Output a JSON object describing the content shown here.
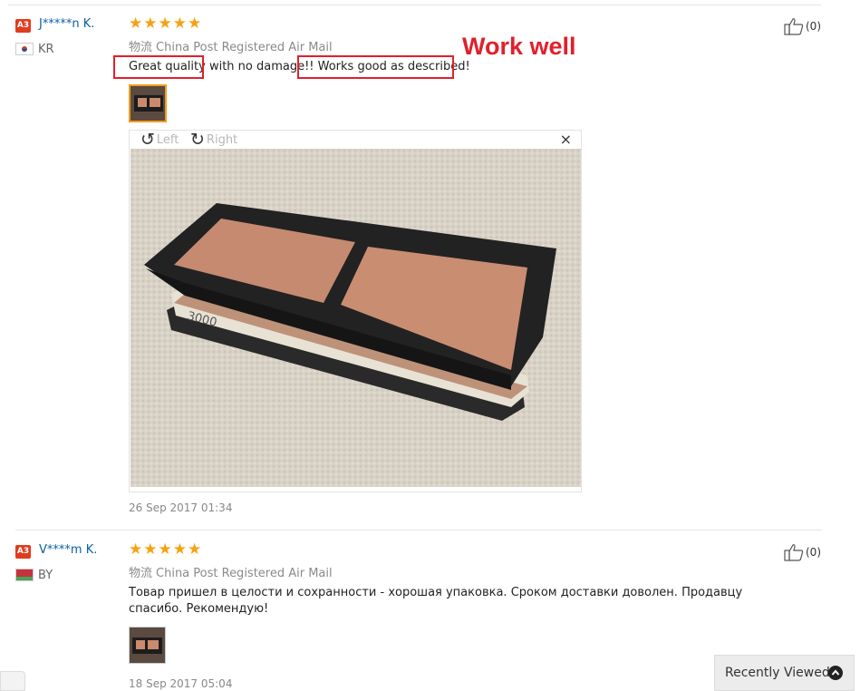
{
  "reviews": [
    {
      "level": "A3",
      "user": "J*****n K.",
      "country": "KR",
      "rating": 5,
      "logistics_label": "物流",
      "logistics": "China Post Registered Air Mail",
      "text_part1": "Great quality",
      "text_part2": " with no damage!! ",
      "text_part3": "Works good as described!",
      "annotation": "Work well",
      "viewer": {
        "left_label": "Left",
        "right_label": "Right",
        "close": "×"
      },
      "date": "26 Sep 2017 01:34",
      "likes": "(0)"
    },
    {
      "level": "A3",
      "user": "V****m K.",
      "country": "BY",
      "rating": 5,
      "logistics_label": "物流",
      "logistics": "China Post Registered Air Mail",
      "text": "Товар пришел в целости и сохранности - хорошая упаковка. Сроком доставки доволен. Продавцу спасибо. Рекомендую!",
      "date": "18 Sep 2017 05:04",
      "likes": "(0)"
    }
  ],
  "recently_viewed": "Recently Viewed",
  "colors": {
    "star": "#f6a214",
    "username": "#0a5fa8",
    "badge": "#e03c1f",
    "annotation": "#e1202c"
  },
  "icons": {
    "like": "thumb-up-icon",
    "rotate_left": "rotate-left-icon",
    "rotate_right": "rotate-right-icon",
    "close": "close-icon",
    "up": "chevron-up-icon"
  }
}
